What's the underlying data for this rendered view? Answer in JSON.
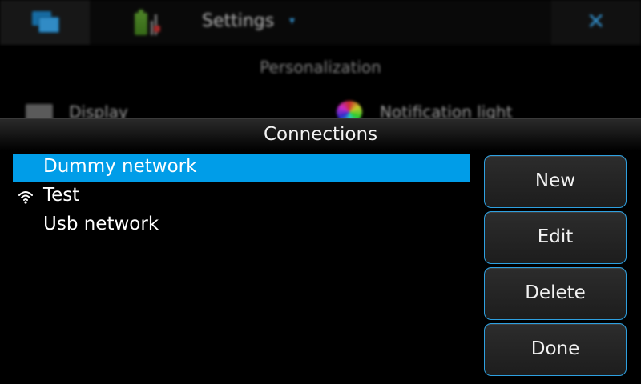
{
  "background": {
    "app_title": "Settings",
    "title_arrow": "▾",
    "section_heading": "Personalization",
    "items": [
      {
        "label": "Display",
        "icon": "display-icon"
      },
      {
        "label": "Notification light",
        "icon": "notification-light-icon"
      }
    ],
    "close_icon": "✕"
  },
  "dialog": {
    "title": "Connections",
    "connections": [
      {
        "label": "Dummy network",
        "selected": true,
        "icon": ""
      },
      {
        "label": "Test",
        "selected": false,
        "icon": "wifi-icon"
      },
      {
        "label": "Usb network",
        "selected": false,
        "icon": ""
      }
    ],
    "buttons": {
      "new_label": "New",
      "edit_label": "Edit",
      "delete_label": "Delete",
      "done_label": "Done"
    }
  },
  "colors": {
    "accent": "#009de8",
    "button_border": "#2ea0e0",
    "background": "#000000",
    "text": "#ffffff"
  }
}
